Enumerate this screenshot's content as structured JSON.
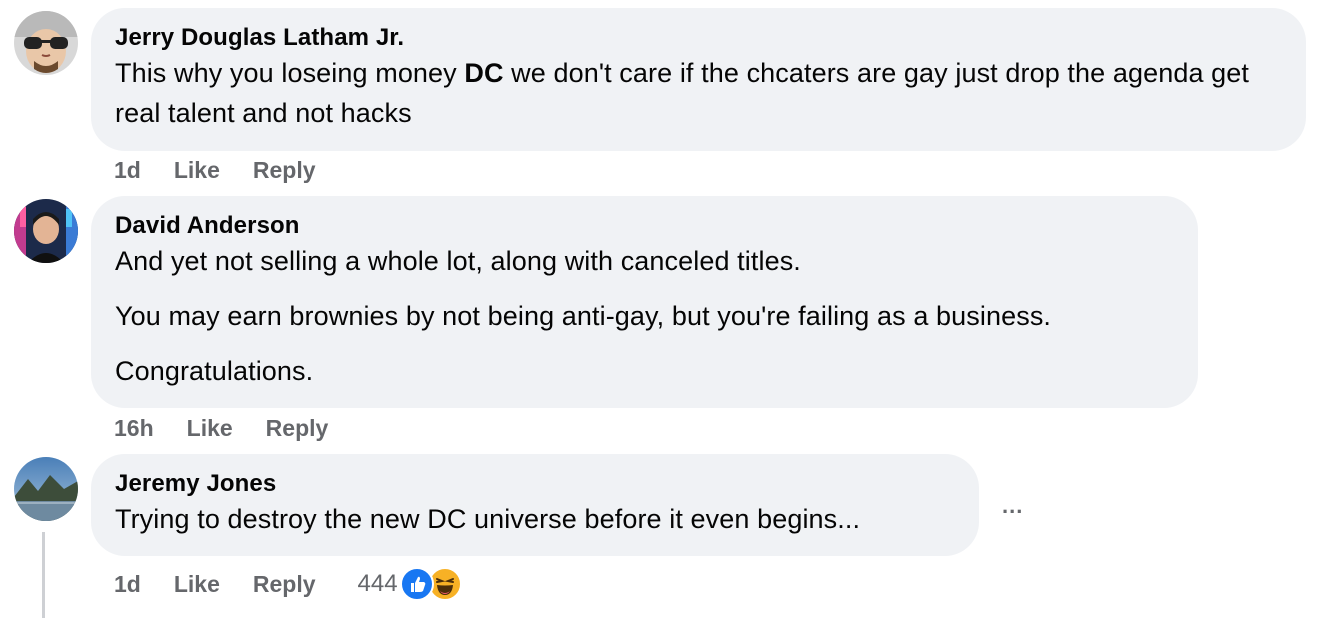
{
  "comments": [
    {
      "author": "Jerry Douglas Latham Jr.",
      "text_before": "This why you loseing money ",
      "text_bold": "DC",
      "text_after": " we don't care if the chcaters are gay just drop the agenda get real talent and not hacks",
      "time": "1d",
      "like_label": "Like",
      "reply_label": "Reply"
    },
    {
      "author": "David Anderson",
      "paragraphs": [
        "And yet not selling a whole lot, along with canceled titles.",
        "You may earn brownies by not being anti-gay, but you're failing as a business.",
        "Congratulations."
      ],
      "time": "16h",
      "like_label": "Like",
      "reply_label": "Reply"
    },
    {
      "author": "Jeremy Jones",
      "text": "Trying to destroy the new DC universe before it even begins...",
      "time": "1d",
      "like_label": "Like",
      "reply_label": "Reply",
      "reaction_count": "444",
      "reactions": [
        "like-reaction-icon",
        "haha-reaction-icon"
      ],
      "more_label": "..."
    }
  ],
  "colors": {
    "bubble": "#f0f2f5",
    "meta": "#65676b",
    "like_blue": "#1877f2",
    "haha_yellow": "#f7b125"
  }
}
